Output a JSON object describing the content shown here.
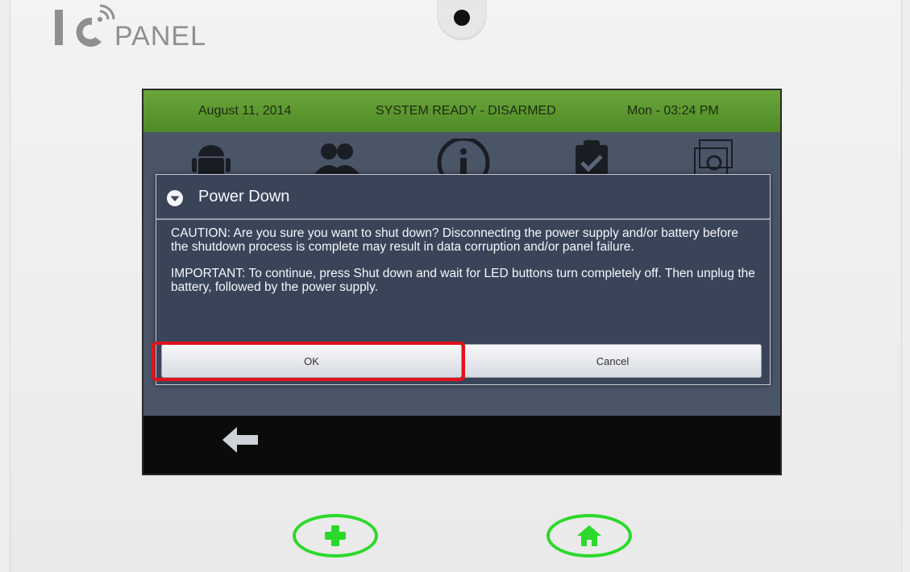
{
  "brand": {
    "logo_text": "PANEL"
  },
  "status_bar": {
    "date": "August 11, 2014",
    "state": "SYSTEM READY - DISARMED",
    "time": "Mon - 03:24 PM"
  },
  "background_icons": [
    {
      "name": "android-icon"
    },
    {
      "name": "users-icon"
    },
    {
      "name": "info-icon"
    },
    {
      "name": "clipboard-check-icon"
    },
    {
      "name": "settings-window-icon"
    }
  ],
  "dialog": {
    "title": "Power Down",
    "caution": "CAUTION: Are you sure you want to shut down? Disconnecting the power supply and/or battery before the shutdown process is complete may result in data corruption and/or panel failure.",
    "important": "IMPORTANT: To continue, press Shut down and wait for LED buttons turn completely off. Then unplug the battery, followed by the power supply.",
    "ok_label": "OK",
    "cancel_label": "Cancel"
  },
  "colors": {
    "status_green": "#5a9a2e",
    "highlight_red": "#e2121d",
    "hardware_button_green": "#2bd92b"
  }
}
